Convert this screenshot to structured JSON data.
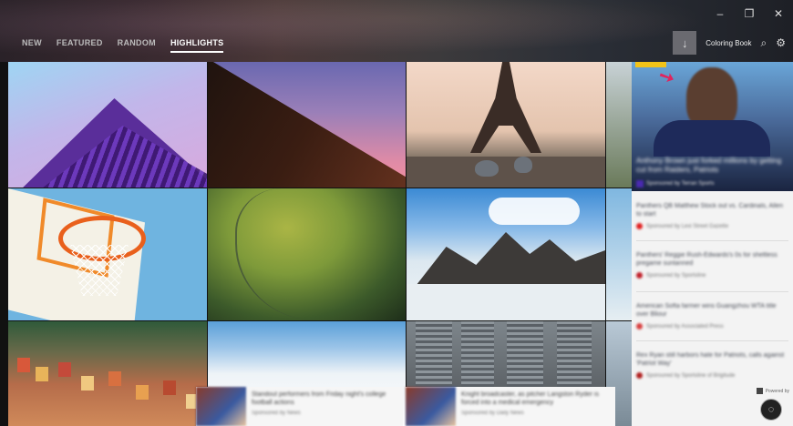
{
  "window": {
    "minimize": "–",
    "maximize": "❐",
    "close": "✕"
  },
  "nav": {
    "tabs": [
      {
        "label": "NEW"
      },
      {
        "label": "FEATURED"
      },
      {
        "label": "RANDOM"
      },
      {
        "label": "HIGHLIGHTS",
        "active": true
      }
    ]
  },
  "toolbar": {
    "download_icon": "↓",
    "collection_label": "Coloring Book",
    "search_icon": "⌕",
    "settings_icon": "⚙"
  },
  "ad_panel": {
    "hero": {
      "title": "Anthony Brown just forked millions by getting cut from Raiders, Patriots",
      "sponsor": "Sponsored by Terran Sports",
      "sponsor_color": "#4a2ab0"
    },
    "items": [
      {
        "title": "Panthers QB Matthew Stock out vs. Cardinals, Allen to start",
        "source": "Sponsored by Lexi Street Gazette",
        "dot": "#e02020"
      },
      {
        "title": "Panthers' Reggie Rush-Edwards's 0s for sheltless pregame suntanned",
        "source": "Sponsored by Sportsline",
        "dot": "#c0202a"
      },
      {
        "title": "American Softa farmer wins Guangzhou WTA title over Bliour",
        "source": "Sponsored by Associated Press",
        "dot": "#d84040"
      },
      {
        "title": "Rex Ryan still harbors hate for Patriots, calls against 'Patriot Way'",
        "source": "Sponsored by Sportsline of Brigitude",
        "dot": "#b02020"
      }
    ],
    "powered_by": "Powered by"
  },
  "bottom_strip": [
    {
      "title": "Standout performers from Friday night's college football actions",
      "source": "Sponsored by News"
    },
    {
      "title": "Knight broadcaster, as pitcher Langston Ryder is forced into a medical emergency",
      "source": "Sponsored by Daily News"
    }
  ],
  "chat_icon": "◌"
}
